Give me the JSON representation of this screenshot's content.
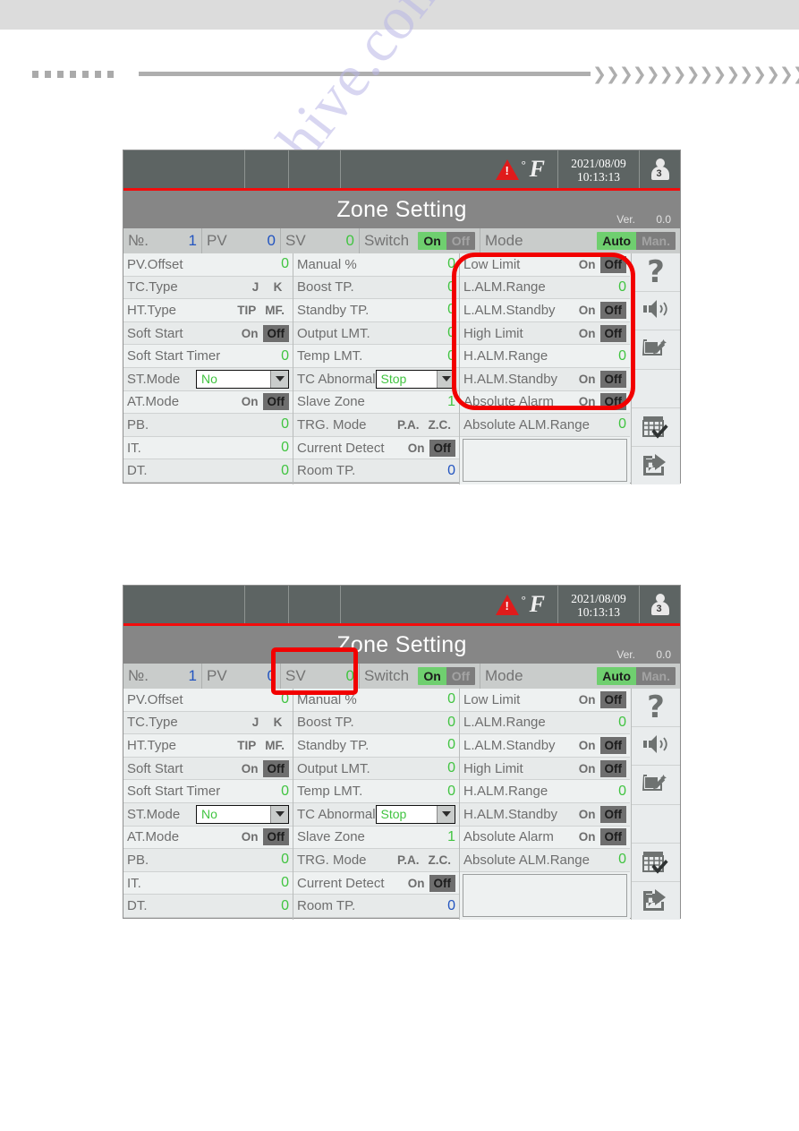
{
  "page": {
    "watermark": "manualshive.com"
  },
  "panel": {
    "statusbar": {
      "warning_icon": "warning-triangle-icon",
      "unit": "F",
      "unit_degree": "°",
      "date": "2021/08/09",
      "time": "10:13:13",
      "user_icon": "user-icon",
      "user_level": "3"
    },
    "title": "Zone Setting",
    "version_label": "Ver.",
    "version_value": "0.0",
    "summary": {
      "no_label": "№.",
      "no_value": "1",
      "pv_label": "PV",
      "pv_value": "0",
      "sv_label": "SV",
      "sv_value": "0",
      "switch_label": "Switch",
      "switch_on": "On",
      "switch_off": "Off",
      "switch_state": "On",
      "mode_label": "Mode",
      "mode_auto": "Auto",
      "mode_man": "Man.",
      "mode_state": "Auto"
    },
    "column1": [
      {
        "label": "PV.Offset",
        "type": "num",
        "value": "0",
        "color": "green"
      },
      {
        "label": "TC.Type",
        "type": "toggle",
        "opt1": "J",
        "opt2": "K",
        "selected": 1
      },
      {
        "label": "HT.Type",
        "type": "toggle",
        "opt1": "TIP",
        "opt2": "MF.",
        "selected": 2
      },
      {
        "label": "Soft Start",
        "type": "toggle",
        "opt1": "On",
        "opt2": "Off",
        "selected": 2
      },
      {
        "label": "Soft Start Timer",
        "type": "num",
        "value": "0",
        "color": "green"
      },
      {
        "label": "ST.Mode",
        "type": "combo",
        "value": "No"
      },
      {
        "label": "AT.Mode",
        "type": "toggle",
        "opt1": "On",
        "opt2": "Off",
        "selected": 2
      },
      {
        "label": "PB.",
        "type": "num",
        "value": "0",
        "color": "green"
      },
      {
        "label": "IT.",
        "type": "num",
        "value": "0",
        "color": "green"
      },
      {
        "label": "DT.",
        "type": "num",
        "value": "0",
        "color": "green"
      }
    ],
    "column2": [
      {
        "label": "Manual %",
        "type": "num",
        "value": "0",
        "color": "green"
      },
      {
        "label": "Boost TP.",
        "type": "num",
        "value": "0",
        "color": "green"
      },
      {
        "label": "Standby TP.",
        "type": "num",
        "value": "0",
        "color": "green"
      },
      {
        "label": "Output LMT.",
        "type": "num",
        "value": "0",
        "color": "green"
      },
      {
        "label": "Temp LMT.",
        "type": "num",
        "value": "0",
        "color": "green"
      },
      {
        "label": "TC Abnormal",
        "type": "combo",
        "value": "Stop"
      },
      {
        "label": "Slave Zone",
        "type": "num",
        "value": "1",
        "color": "green"
      },
      {
        "label": "TRG. Mode",
        "type": "toggle",
        "opt1": "P.A.",
        "opt2": "Z.C.",
        "selected": 2
      },
      {
        "label": "Current Detect",
        "type": "toggle",
        "opt1": "On",
        "opt2": "Off",
        "selected": 2
      },
      {
        "label": "Room TP.",
        "type": "num",
        "value": "0",
        "color": "blue"
      }
    ],
    "column3": [
      {
        "label": "Low Limit",
        "type": "toggle",
        "opt1": "On",
        "opt2": "Off",
        "selected": 2
      },
      {
        "label": "L.ALM.Range",
        "type": "num",
        "value": "0",
        "color": "green"
      },
      {
        "label": "L.ALM.Standby",
        "type": "toggle",
        "opt1": "On",
        "opt2": "Off",
        "selected": 2
      },
      {
        "label": "High Limit",
        "type": "toggle",
        "opt1": "On",
        "opt2": "Off",
        "selected": 2
      },
      {
        "label": "H.ALM.Range",
        "type": "num",
        "value": "0",
        "color": "green"
      },
      {
        "label": "H.ALM.Standby",
        "type": "toggle",
        "opt1": "On",
        "opt2": "Off",
        "selected": 2
      },
      {
        "label": "Absolute Alarm",
        "type": "toggle",
        "opt1": "On",
        "opt2": "Off",
        "selected": 2
      },
      {
        "label": "Absolute ALM.Range",
        "type": "num",
        "value": "0",
        "color": "green"
      },
      {
        "label": "",
        "type": "blank"
      }
    ],
    "sidebar": [
      {
        "icon": "help-question-icon",
        "label": "?"
      },
      {
        "icon": "speaker-volume-icon",
        "label": ""
      },
      {
        "icon": "edit-note-icon",
        "label": ""
      },
      {
        "icon": "blank-icon",
        "label": ""
      },
      {
        "icon": "table-check-icon",
        "label": ""
      },
      {
        "icon": "share-export-icon",
        "label": ""
      }
    ]
  },
  "annotations": {
    "panel1_highlight": "alarm-settings-column-highlight",
    "panel2_highlight": "sv-field-highlight"
  },
  "colors": {
    "accent_red": "#f20000",
    "active_green": "#6fcf6f",
    "value_green": "#41c441",
    "value_blue": "#2254c0",
    "statusbar_bg": "#5d6463",
    "title_bg": "#868686"
  }
}
